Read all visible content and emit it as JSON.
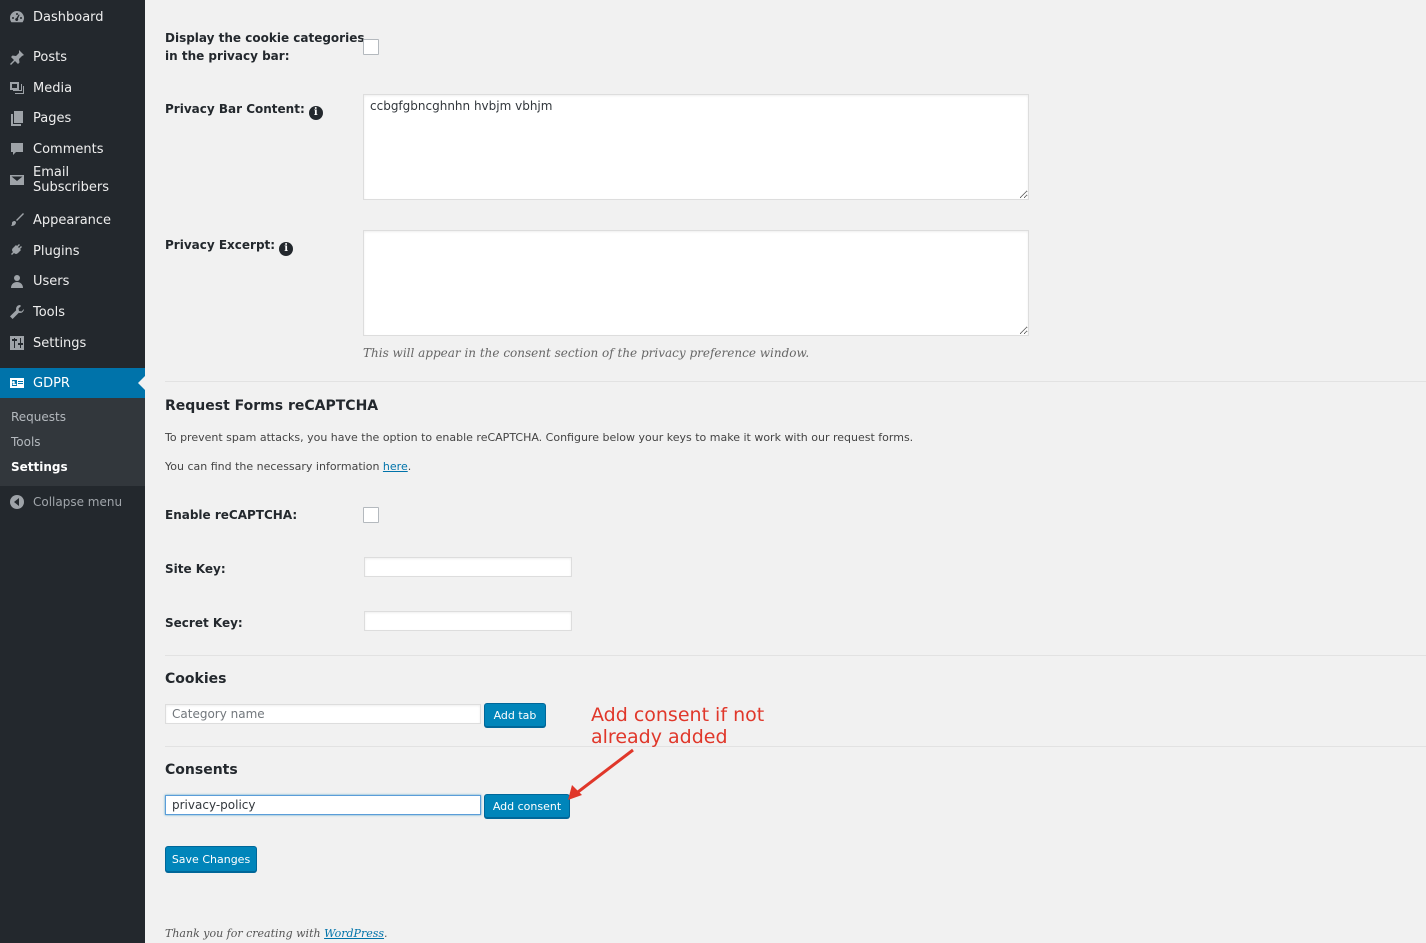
{
  "sidebar": {
    "items": [
      {
        "label": "Dashboard",
        "icon": "dashboard-icon"
      },
      {
        "label": "Posts",
        "icon": "pin-icon"
      },
      {
        "label": "Media",
        "icon": "media-icon"
      },
      {
        "label": "Pages",
        "icon": "pages-icon"
      },
      {
        "label": "Comments",
        "icon": "comment-icon"
      },
      {
        "label": "Email Subscribers",
        "icon": "envelope-icon"
      },
      {
        "label": "Appearance",
        "icon": "brush-icon"
      },
      {
        "label": "Plugins",
        "icon": "plug-icon"
      },
      {
        "label": "Users",
        "icon": "user-icon"
      },
      {
        "label": "Tools",
        "icon": "wrench-icon"
      },
      {
        "label": "Settings",
        "icon": "sliders-icon"
      },
      {
        "label": "GDPR",
        "icon": "id-card-icon"
      }
    ],
    "submenu": [
      "Requests",
      "Tools",
      "Settings"
    ],
    "collapse_label": "Collapse menu"
  },
  "privacy": {
    "display_categories_label": "Display the cookie categories",
    "display_categories_label2": "in the privacy bar:",
    "display_categories_checked": false,
    "bar_content_label": "Privacy Bar Content:",
    "bar_content_value": "ccbgfgbncghnhn hvbjm vbhjm",
    "excerpt_label": "Privacy Excerpt:",
    "excerpt_value": "",
    "excerpt_desc": "This will appear in the consent section of the privacy preference window."
  },
  "recaptcha": {
    "heading": "Request Forms reCAPTCHA",
    "desc1": "To prevent spam attacks, you have the option to enable reCAPTCHA. Configure below your keys to make it work with our request forms.",
    "desc2_prefix": "You can find the necessary information ",
    "desc2_link": "here",
    "desc2_suffix": ".",
    "enable_label": "Enable reCAPTCHA:",
    "enable_checked": false,
    "site_key_label": "Site Key:",
    "site_key_value": "",
    "secret_key_label": "Secret Key:",
    "secret_key_value": ""
  },
  "cookies": {
    "heading": "Cookies",
    "input_placeholder": "Category name",
    "button": "Add tab"
  },
  "consents": {
    "heading": "Consents",
    "input_value": "privacy-policy",
    "button": "Add consent"
  },
  "annotation": {
    "line1": "Add consent if not",
    "line2": "already added",
    "color": "#e0372a"
  },
  "save_button": "Save Changes",
  "footer": {
    "prefix": "Thank you for creating with ",
    "link": "WordPress",
    "suffix": "."
  },
  "colors": {
    "accent": "#0073aa",
    "button": "#0085ba",
    "sidebar": "#23282d"
  }
}
